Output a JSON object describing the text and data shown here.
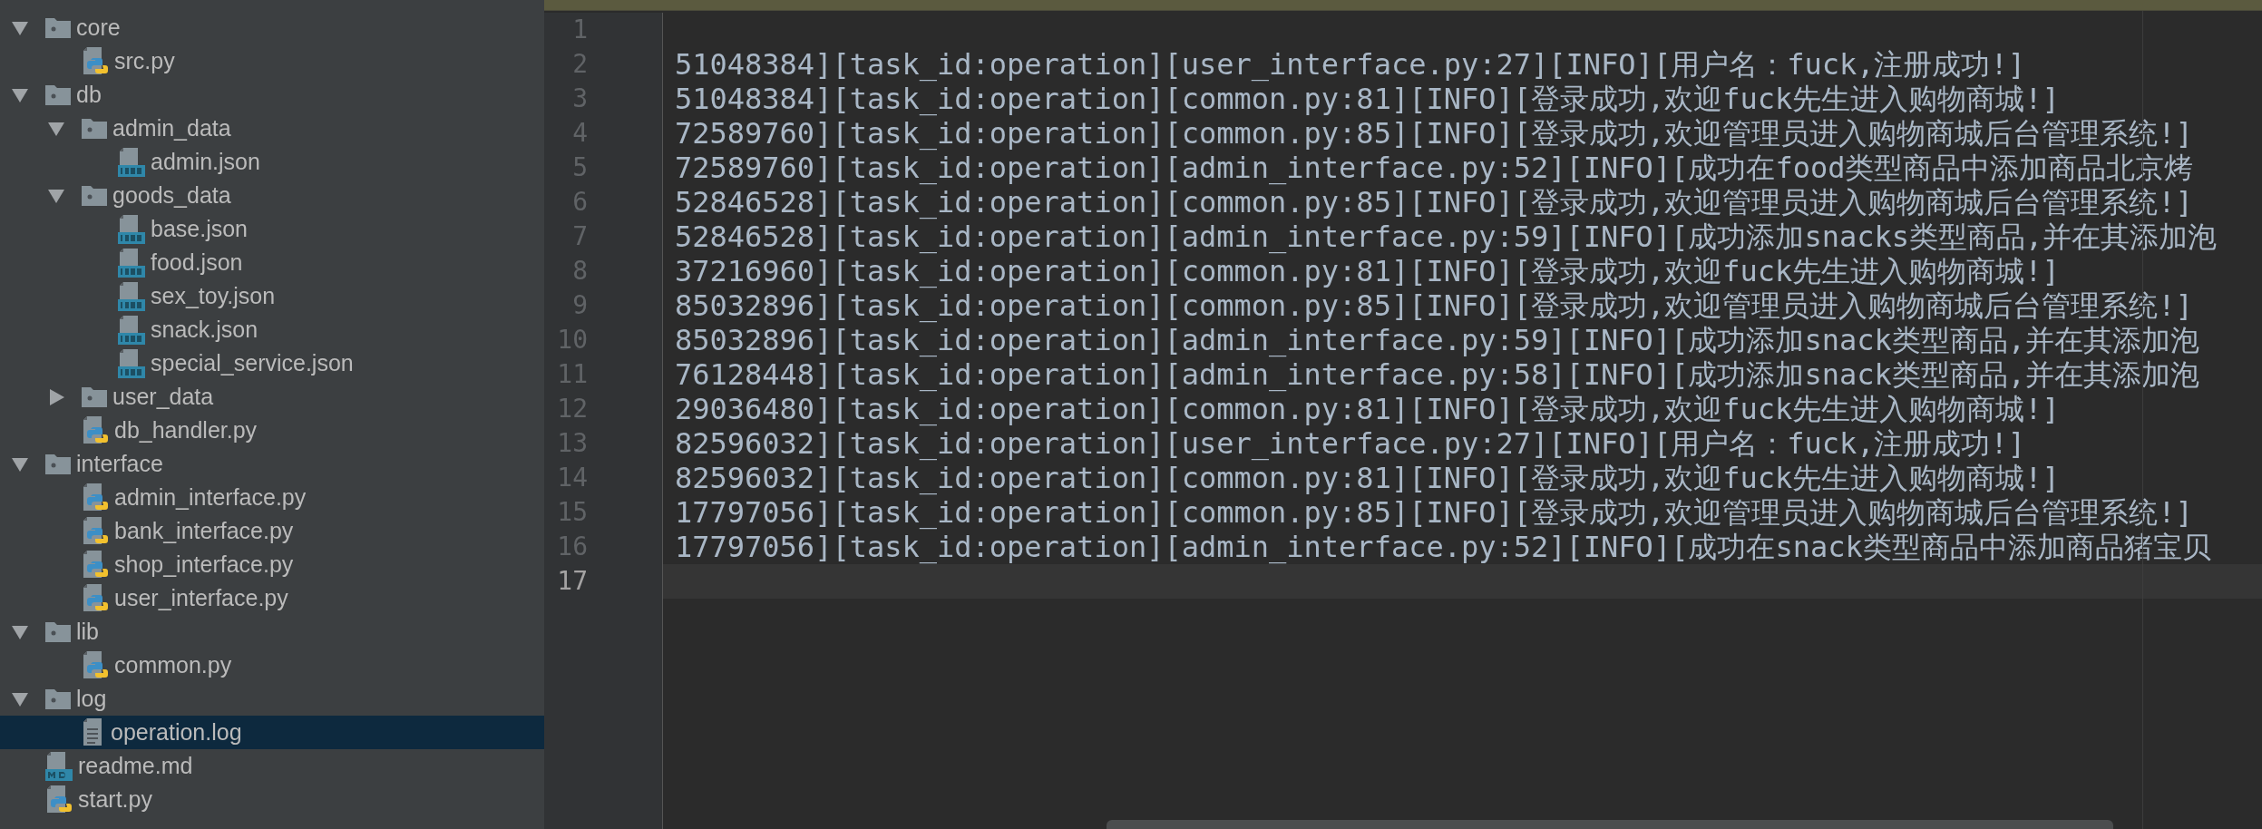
{
  "project_tree": [
    {
      "name": "core",
      "kind": "folder",
      "expanded": true,
      "selected": false,
      "children": [
        {
          "name": "src.py",
          "kind": "python",
          "selected": false
        }
      ]
    },
    {
      "name": "db",
      "kind": "folder",
      "expanded": true,
      "selected": false,
      "children": [
        {
          "name": "admin_data",
          "kind": "folder",
          "expanded": true,
          "selected": false,
          "children": [
            {
              "name": "admin.json",
              "kind": "json",
              "selected": false
            }
          ]
        },
        {
          "name": "goods_data",
          "kind": "folder",
          "expanded": true,
          "selected": false,
          "children": [
            {
              "name": "base.json",
              "kind": "json",
              "selected": false
            },
            {
              "name": "food.json",
              "kind": "json",
              "selected": false
            },
            {
              "name": "sex_toy.json",
              "kind": "json",
              "selected": false
            },
            {
              "name": "snack.json",
              "kind": "json",
              "selected": false
            },
            {
              "name": "special_service.json",
              "kind": "json",
              "selected": false
            }
          ]
        },
        {
          "name": "user_data",
          "kind": "folder",
          "expanded": false,
          "selected": false
        },
        {
          "name": "db_handler.py",
          "kind": "python",
          "selected": false
        }
      ]
    },
    {
      "name": "interface",
      "kind": "folder",
      "expanded": true,
      "selected": false,
      "children": [
        {
          "name": "admin_interface.py",
          "kind": "python",
          "selected": false
        },
        {
          "name": "bank_interface.py",
          "kind": "python",
          "selected": false
        },
        {
          "name": "shop_interface.py",
          "kind": "python",
          "selected": false
        },
        {
          "name": "user_interface.py",
          "kind": "python",
          "selected": false
        }
      ]
    },
    {
      "name": "lib",
      "kind": "folder",
      "expanded": true,
      "selected": false,
      "children": [
        {
          "name": "common.py",
          "kind": "python",
          "selected": false
        }
      ]
    },
    {
      "name": "log",
      "kind": "folder",
      "expanded": true,
      "selected": false,
      "children": [
        {
          "name": "operation.log",
          "kind": "log",
          "selected": true
        }
      ]
    },
    {
      "name": "readme.md",
      "kind": "markdown",
      "selected": false
    },
    {
      "name": "start.py",
      "kind": "python",
      "selected": false
    }
  ],
  "editor": {
    "lines": [
      {
        "number": "1",
        "current": false
      },
      {
        "number": "2",
        "current": false,
        "text": "51048384][task_id:operation][user_interface.py:27][INFO][用户名：fuck,注册成功!]"
      },
      {
        "number": "3",
        "current": false,
        "text": "51048384][task_id:operation][common.py:81][INFO][登录成功,欢迎fuck先生进入购物商城!]"
      },
      {
        "number": "4",
        "current": false,
        "text": "72589760][task_id:operation][common.py:85][INFO][登录成功,欢迎管理员进入购物商城后台管理系统!]"
      },
      {
        "number": "5",
        "current": false,
        "text": "72589760][task_id:operation][admin_interface.py:52][INFO][成功在food类型商品中添加商品北京烤"
      },
      {
        "number": "6",
        "current": false,
        "text": "52846528][task_id:operation][common.py:85][INFO][登录成功,欢迎管理员进入购物商城后台管理系统!]"
      },
      {
        "number": "7",
        "current": false,
        "text": "52846528][task_id:operation][admin_interface.py:59][INFO][成功添加snacks类型商品,并在其添加泡"
      },
      {
        "number": "8",
        "current": false,
        "text": "37216960][task_id:operation][common.py:81][INFO][登录成功,欢迎fuck先生进入购物商城!]"
      },
      {
        "number": "9",
        "current": false,
        "text": "85032896][task_id:operation][common.py:85][INFO][登录成功,欢迎管理员进入购物商城后台管理系统!]"
      },
      {
        "number": "10",
        "current": false,
        "text": "85032896][task_id:operation][admin_interface.py:59][INFO][成功添加snack类型商品,并在其添加泡"
      },
      {
        "number": "11",
        "current": false,
        "text": "76128448][task_id:operation][admin_interface.py:58][INFO][成功添加snack类型商品,并在其添加泡"
      },
      {
        "number": "12",
        "current": false,
        "text": "29036480][task_id:operation][common.py:81][INFO][登录成功,欢迎fuck先生进入购物商城!]"
      },
      {
        "number": "13",
        "current": false,
        "text": "82596032][task_id:operation][user_interface.py:27][INFO][用户名：fuck,注册成功!]"
      },
      {
        "number": "14",
        "current": false,
        "text": "82596032][task_id:operation][common.py:81][INFO][登录成功,欢迎fuck先生进入购物商城!]"
      },
      {
        "number": "15",
        "current": false,
        "text": "17797056][task_id:operation][common.py:85][INFO][登录成功,欢迎管理员进入购物商城后台管理系统!]"
      },
      {
        "number": "16",
        "current": false,
        "text": "17797056][task_id:operation][admin_interface.py:52][INFO][成功在snack类型商品中添加商品猪宝贝"
      },
      {
        "number": "17",
        "current": true
      }
    ]
  }
}
